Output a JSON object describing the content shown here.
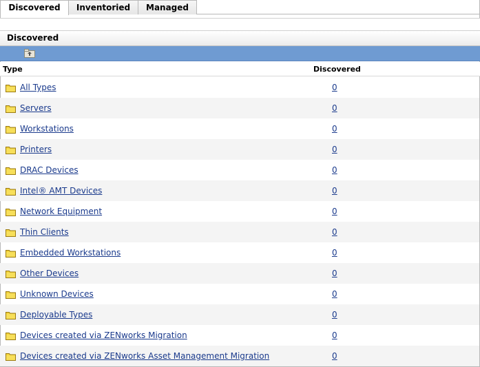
{
  "tabs": [
    {
      "label": "Discovered",
      "active": true
    },
    {
      "label": "Inventoried",
      "active": false
    },
    {
      "label": "Managed",
      "active": false
    }
  ],
  "panel": {
    "title": "Discovered",
    "toolbar_color": "#6f9bd2",
    "up_icon": "folder-up-icon"
  },
  "table": {
    "columns": [
      "Type",
      "Discovered"
    ],
    "rows": [
      {
        "type": "All Types",
        "count": "0"
      },
      {
        "type": "Servers",
        "count": "0"
      },
      {
        "type": "Workstations",
        "count": "0"
      },
      {
        "type": "Printers",
        "count": "0"
      },
      {
        "type": "DRAC Devices",
        "count": "0"
      },
      {
        "type": "Intel® AMT Devices",
        "count": "0"
      },
      {
        "type": "Network Equipment",
        "count": "0"
      },
      {
        "type": "Thin Clients",
        "count": "0"
      },
      {
        "type": "Embedded Workstations",
        "count": "0"
      },
      {
        "type": "Other Devices",
        "count": "0"
      },
      {
        "type": "Unknown Devices",
        "count": "0"
      },
      {
        "type": "Deployable Types",
        "count": "0"
      },
      {
        "type": "Devices created via ZENworks Migration",
        "count": "0"
      },
      {
        "type": "Devices created via ZENworks Asset Management Migration",
        "count": "0"
      }
    ],
    "row_icon": "folder-icon"
  }
}
